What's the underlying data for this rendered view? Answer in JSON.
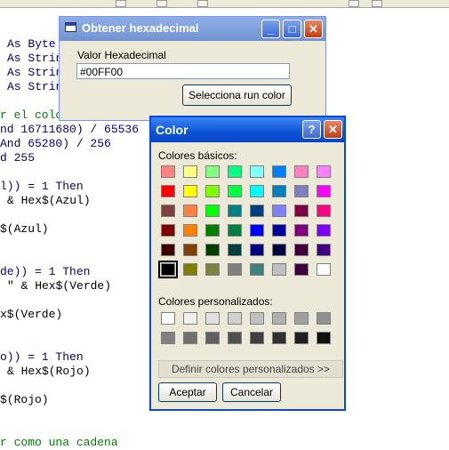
{
  "editor": {
    "lines": [
      {
        "text": "As Byte",
        "type": "kw"
      },
      {
        "text": "As Strin",
        "type": "kw"
      },
      {
        "text": "As Strin",
        "type": "kw"
      },
      {
        "text": "As Strin",
        "type": "kw"
      },
      {
        "text": "r el colo",
        "type": "cm"
      },
      {
        "text": "nd 16711680) / 65536",
        "type": "kw"
      },
      {
        "text": "And 65280) / 256",
        "type": "kw"
      },
      {
        "text": "d 255",
        "type": "kw"
      },
      {
        "text": "l)) = 1 Then",
        "type": "kw"
      },
      {
        "text": "& Hex$(Azul)",
        "type": "tx"
      },
      {
        "text": "$(Azul)",
        "type": "tx"
      },
      {
        "text": "de)) = 1 Then",
        "type": "kw"
      },
      {
        "text": "\" & Hex$(Verde)",
        "type": "tx"
      },
      {
        "text": "x$(Verde)",
        "type": "tx"
      },
      {
        "text": "o)) = 1 Then",
        "type": "kw"
      },
      {
        "text": "& Hex$(Rojo)",
        "type": "tx"
      },
      {
        "text": "$(Rojo)",
        "type": "tx"
      },
      {
        "text": "r como una cadena",
        "type": "cm"
      }
    ]
  },
  "hexDialog": {
    "title": "Obtener hexadecimal",
    "label": "Valor Hexadecimal",
    "value": "#00FF00",
    "button": "Selecciona run color"
  },
  "colorDialog": {
    "title": "Color",
    "help": "?",
    "close": "✕",
    "basicLabel": "Colores básicos:",
    "customLabel": "Colores personalizados:",
    "defineButton": "Definir colores personalizados >>",
    "okButton": "Aceptar",
    "cancelButton": "Cancelar",
    "selectedBasicIndex": 40,
    "basicColors": [
      "#ff8080",
      "#ffff80",
      "#80ff80",
      "#00ff80",
      "#80ffff",
      "#0080ff",
      "#ff80c0",
      "#ff80ff",
      "#ff0000",
      "#ffff00",
      "#80ff00",
      "#00ff40",
      "#00ffff",
      "#0080c0",
      "#8080c0",
      "#ff00ff",
      "#804040",
      "#ff8040",
      "#00ff00",
      "#008080",
      "#004080",
      "#8080ff",
      "#800040",
      "#ff0080",
      "#800000",
      "#ff8000",
      "#008000",
      "#008040",
      "#0000ff",
      "#0000a0",
      "#800080",
      "#8000ff",
      "#400000",
      "#804000",
      "#004000",
      "#004040",
      "#000080",
      "#000040",
      "#400040",
      "#400080",
      "#000000",
      "#808000",
      "#808040",
      "#808080",
      "#408080",
      "#c0c0c0",
      "#400040",
      "#ffffff"
    ],
    "customColors": [
      "#ffffff",
      "#f0f0f0",
      "#e0e0e0",
      "#d0d0d0",
      "#c0c0c0",
      "#b0b0b0",
      "#a0a0a0",
      "#909090",
      "#808080",
      "#707070",
      "#606060",
      "#505050",
      "#404040",
      "#303030",
      "#202020",
      "#101010"
    ]
  }
}
